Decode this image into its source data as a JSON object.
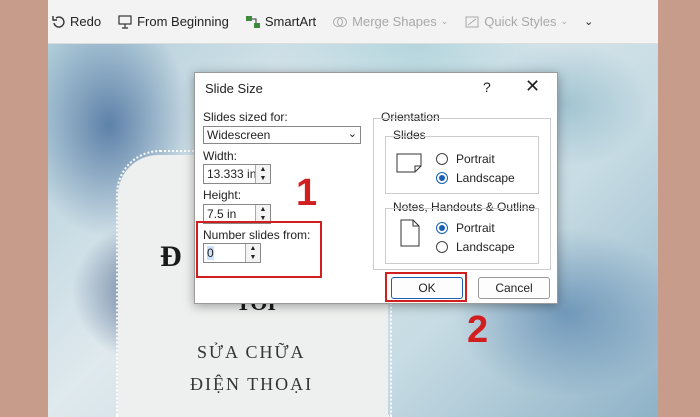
{
  "ribbon": {
    "redo": "Redo",
    "from_beginning": "From Beginning",
    "smartart": "SmartArt",
    "merge_shapes": "Merge Shapes",
    "quick_styles": "Quick Styles"
  },
  "slide": {
    "big_text": "Đ",
    "big_text2": "TOI",
    "sub1": "SỬA CHỮA",
    "sub2": "ĐIỆN THOẠI"
  },
  "dialog": {
    "title": "Slide Size",
    "help": "?",
    "close": "✕",
    "slides_sized_for_label": "Slides sized for:",
    "slides_sized_for_value": "Widescreen",
    "width_label": "Width:",
    "width_value": "13.333 in",
    "height_label": "Height:",
    "height_value": "7.5 in",
    "number_from_label": "Number slides from:",
    "number_from_value": "0",
    "orientation_label": "Orientation",
    "slides_group_label": "Slides",
    "slides_portrait": "Portrait",
    "slides_landscape": "Landscape",
    "notes_group_label": "Notes, Handouts & Outline",
    "notes_portrait": "Portrait",
    "notes_landscape": "Landscape",
    "ok": "OK",
    "cancel": "Cancel"
  },
  "annotations": {
    "step1": "1",
    "step2": "2"
  },
  "colors": {
    "highlight": "#d11e1e",
    "accent": "#1a5fb4"
  }
}
